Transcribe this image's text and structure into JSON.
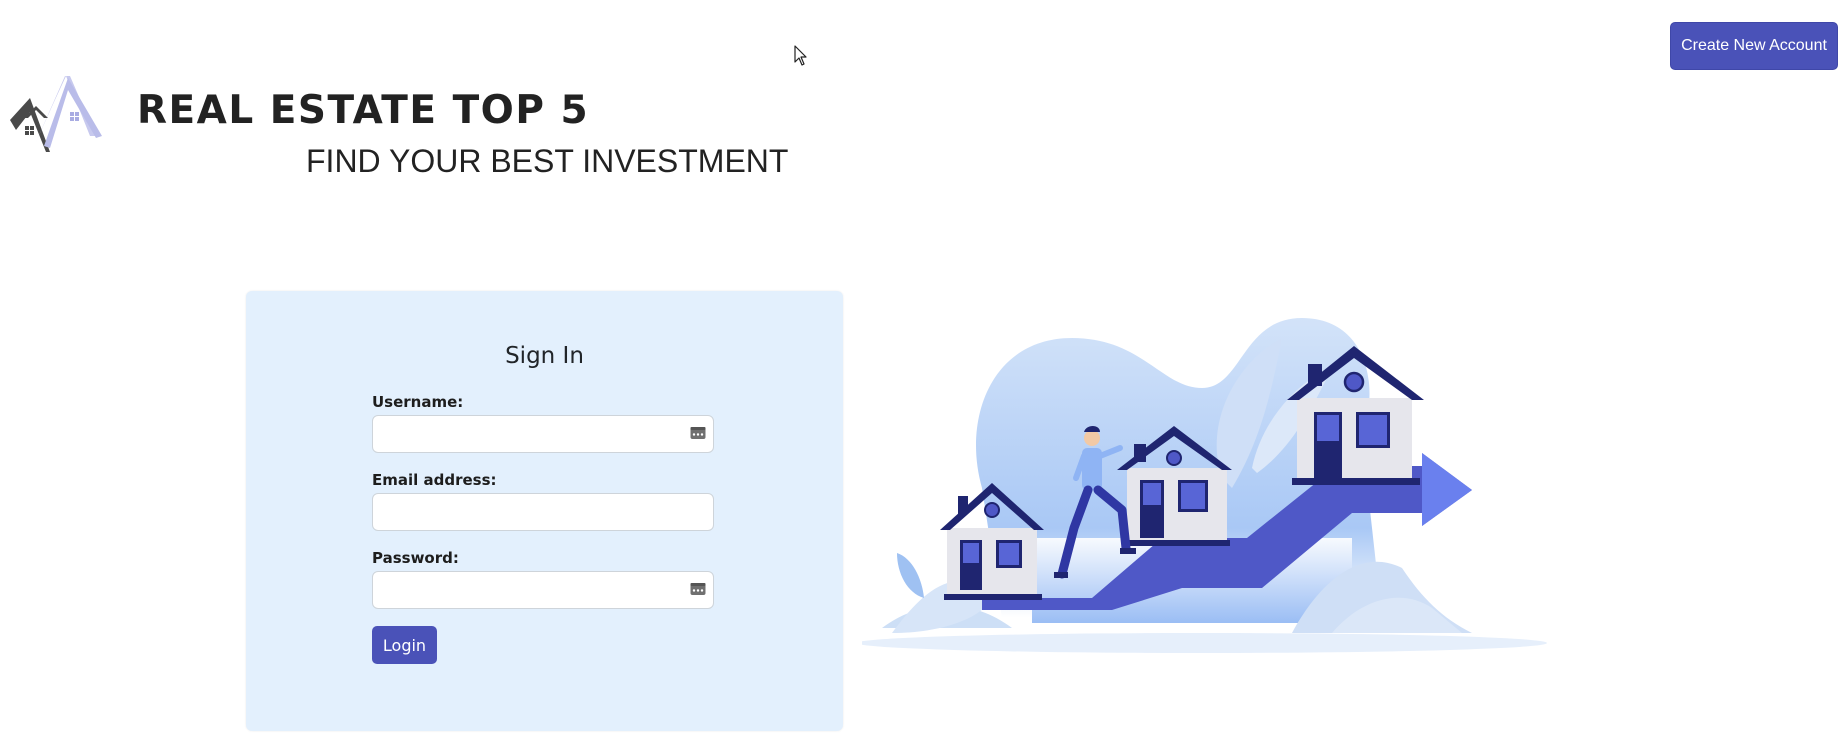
{
  "header": {
    "create_account_label": "Create New Account",
    "brand_title": "REAL ESTATE TOP 5",
    "brand_subtitle": "FIND YOUR BEST INVESTMENT"
  },
  "signin": {
    "title": "Sign In",
    "username_label": "Username:",
    "username_value": "",
    "email_label": "Email address:",
    "email_value": "",
    "password_label": "Password:",
    "password_value": "",
    "login_label": "Login"
  },
  "icons": {
    "logo": "house-mountain-logo",
    "autofill": "autofill-key-icon",
    "cursor": "mouse-pointer-icon",
    "illustration": "houses-growth-arrow-illustration"
  },
  "colors": {
    "primary": "#4a52b8",
    "card_background": "#e3f0fd",
    "text": "#222222"
  }
}
